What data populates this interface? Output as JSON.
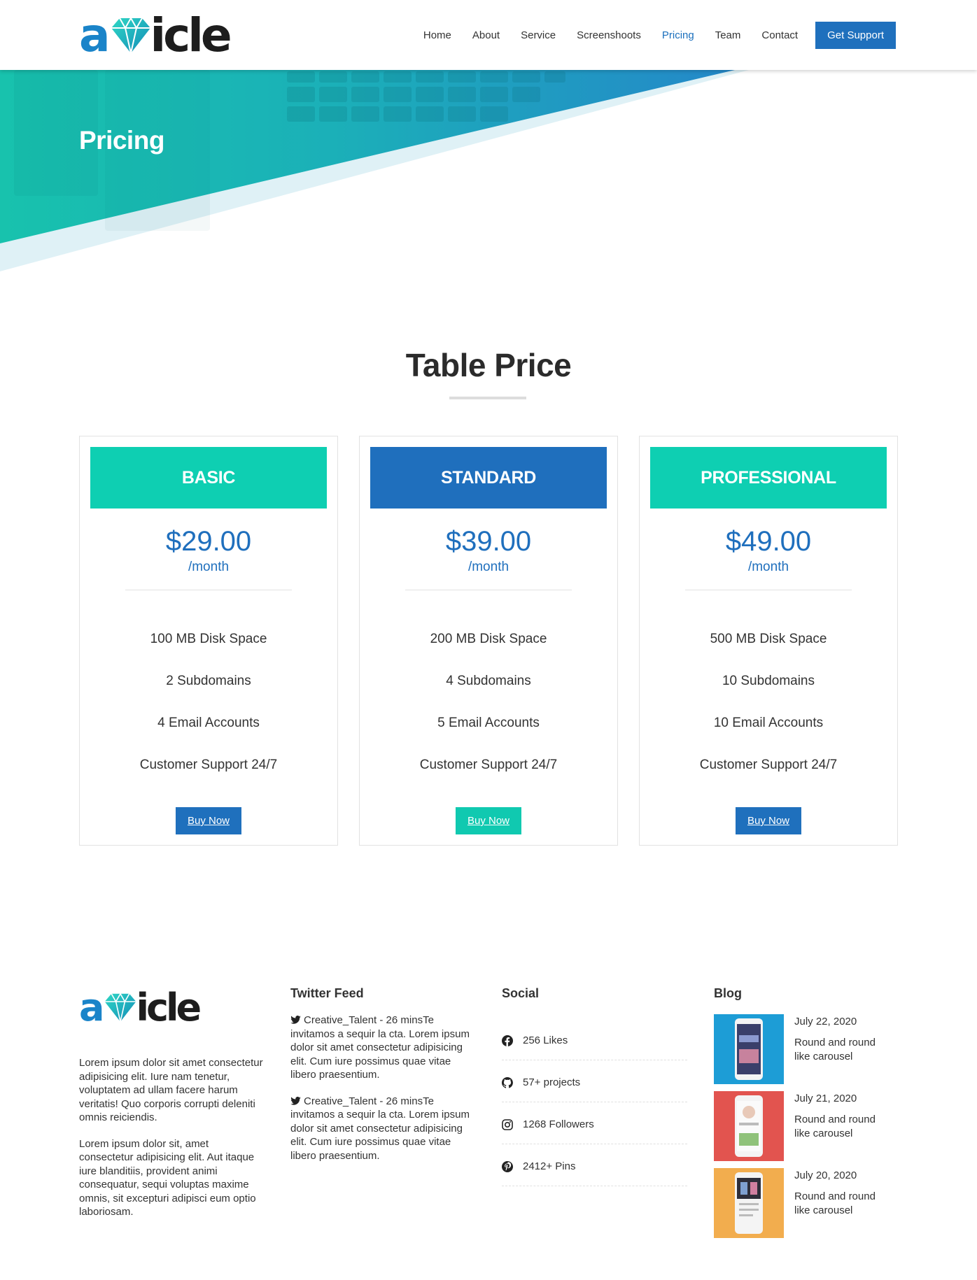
{
  "brand": {
    "logo_text_a": "a",
    "logo_text_rest": "icle",
    "icon": "diamond-icon",
    "primary_color": "#1f70bd",
    "accent_color": "#10c9b0"
  },
  "nav": {
    "items": [
      {
        "label": "Home",
        "active": false
      },
      {
        "label": "About",
        "active": false
      },
      {
        "label": "Service",
        "active": false
      },
      {
        "label": "Screenshoots",
        "active": false
      },
      {
        "label": "Pricing",
        "active": true
      },
      {
        "label": "Team",
        "active": false
      },
      {
        "label": "Contact",
        "active": false
      }
    ],
    "cta_label": "Get Support"
  },
  "hero": {
    "title": "Pricing"
  },
  "pricing": {
    "title": "Table Price",
    "plans": [
      {
        "name": "BASIC",
        "header_color": "#0ecfb2",
        "price": "$29.00",
        "period": "/month",
        "features": [
          "100 MB Disk Space",
          "2 Subdomains",
          "4 Email Accounts",
          "Customer Support 24/7"
        ],
        "button_label": "Buy Now",
        "button_color": "#1f70bd"
      },
      {
        "name": "STANDARD",
        "header_color": "#1f6fbd",
        "price": "$39.00",
        "period": "/month",
        "features": [
          "200 MB Disk Space",
          "4 Subdomains",
          "5 Email Accounts",
          "Customer Support 24/7"
        ],
        "button_label": "Buy Now",
        "button_color": "#10c9b0"
      },
      {
        "name": "PROFESSIONAL",
        "header_color": "#0ecfb2",
        "price": "$49.00",
        "period": "/month",
        "features": [
          "500 MB Disk Space",
          "10 Subdomains",
          "10 Email Accounts",
          "Customer Support 24/7"
        ],
        "button_label": "Buy Now",
        "button_color": "#1f70bd"
      }
    ]
  },
  "footer": {
    "about": {
      "paragraphs": [
        "Lorem ipsum dolor sit amet consectetur adipisicing elit. Iure nam tenetur, voluptatem ad ullam facere harum veritatis! Quo corporis corrupti deleniti omnis reiciendis.",
        "Lorem ipsum dolor sit, amet consectetur adipisicing elit. Aut itaque iure blanditiis, provident animi consequatur, sequi voluptas maxime omnis, sit excepturi adipisci eum optio laboriosam."
      ]
    },
    "twitter": {
      "heading": "Twitter Feed",
      "icon": "twitter-icon",
      "tweets": [
        "Creative_Talent - 26 minsTe invitamos a sequir la cta. Lorem ipsum dolor sit amet consectetur adipisicing elit. Cum iure possimus quae vitae libero praesentium.",
        "Creative_Talent - 26 minsTe invitamos a sequir la cta. Lorem ipsum dolor sit amet consectetur adipisicing elit. Cum iure possimus quae vitae libero praesentium."
      ]
    },
    "social": {
      "heading": "Social",
      "items": [
        {
          "icon": "facebook-icon",
          "label": "256 Likes"
        },
        {
          "icon": "github-icon",
          "label": "57+ projects"
        },
        {
          "icon": "instagram-icon",
          "label": "1268 Followers"
        },
        {
          "icon": "pinterest-icon",
          "label": "2412+ Pins"
        }
      ]
    },
    "blog": {
      "heading": "Blog",
      "posts": [
        {
          "date": "July 22, 2020",
          "title": "Round and round like carousel",
          "thumb_color": "#1d9dd6"
        },
        {
          "date": "July 21, 2020",
          "title": "Round and round like carousel",
          "thumb_color": "#e2544f"
        },
        {
          "date": "July 20, 2020",
          "title": "Round and round like carousel",
          "thumb_color": "#f2ad4e"
        }
      ]
    }
  }
}
